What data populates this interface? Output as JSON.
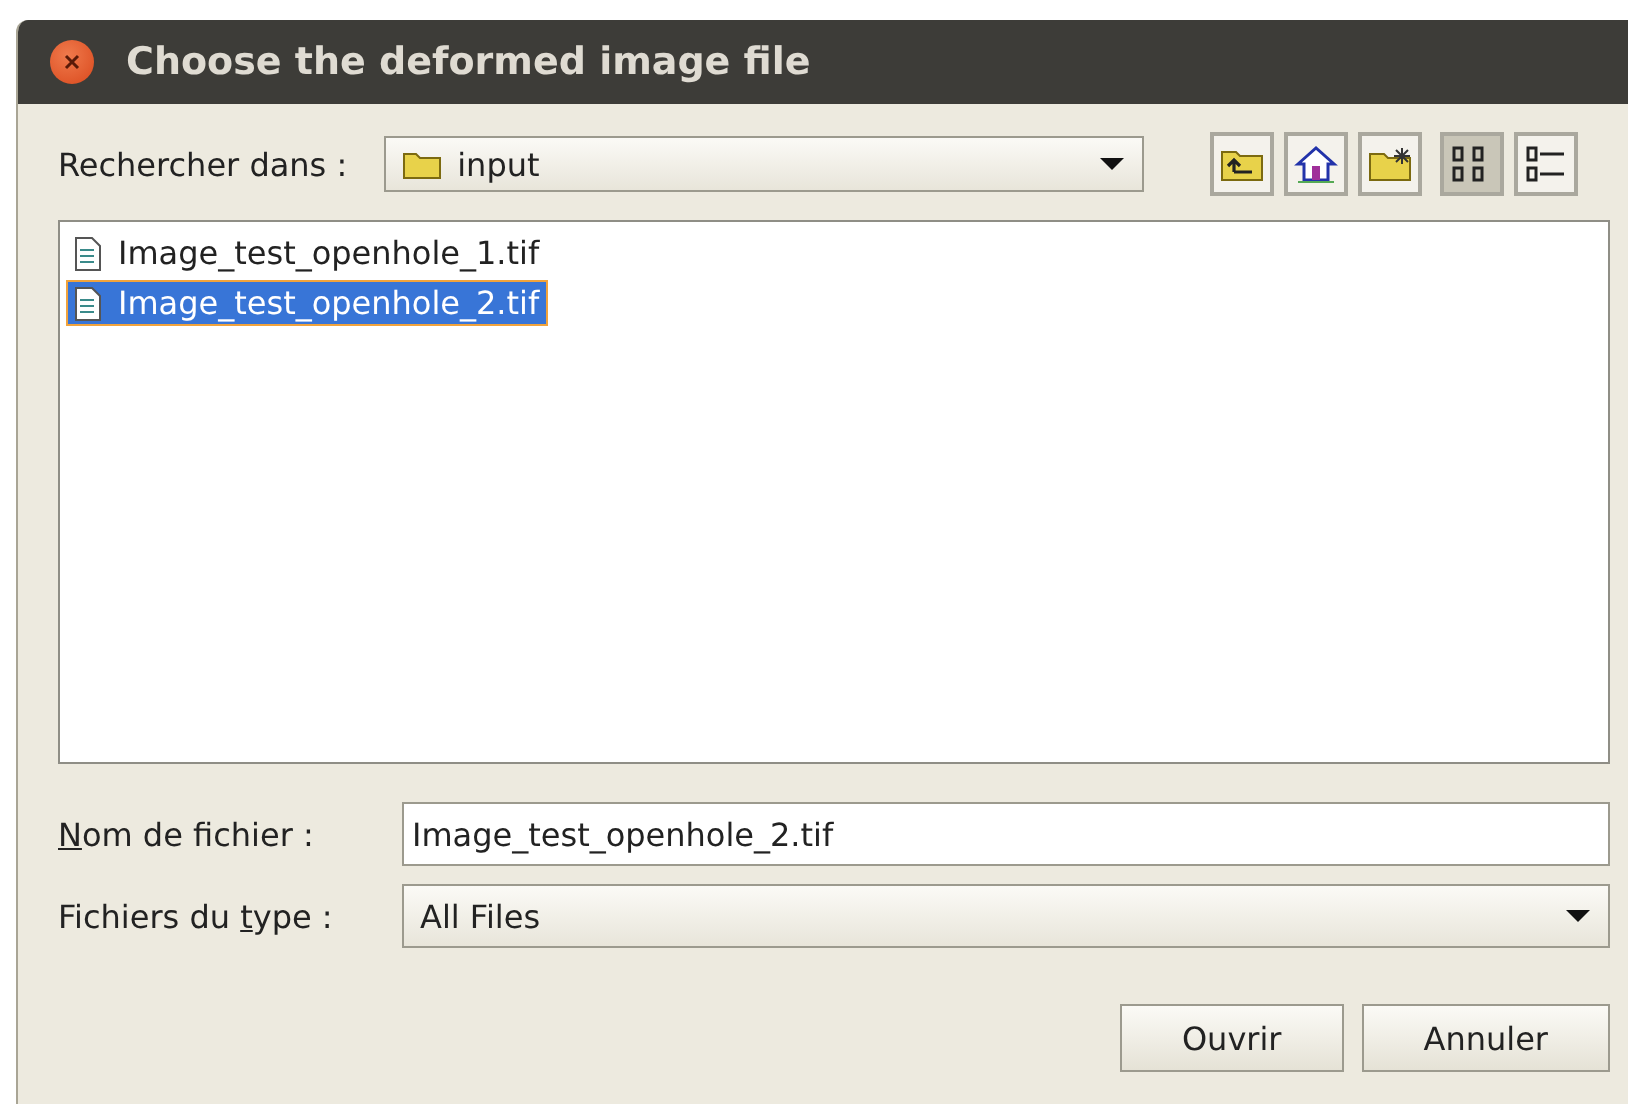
{
  "window": {
    "title": "Choose the deformed image file"
  },
  "look_in": {
    "label": "Rechercher dans :",
    "value": "input"
  },
  "toolbar": [
    {
      "kind": "up",
      "selected": false
    },
    {
      "kind": "home",
      "selected": false
    },
    {
      "kind": "new-folder",
      "selected": false
    },
    {
      "kind": "list-view",
      "selected": true
    },
    {
      "kind": "details-view",
      "selected": false
    }
  ],
  "files": [
    {
      "name": "Image_test_openhole_1.tif",
      "selected": false
    },
    {
      "name": "Image_test_openhole_2.tif",
      "selected": true
    }
  ],
  "file_name": {
    "label": [
      {
        "text": "N",
        "underlined": true
      },
      {
        "text": "om de fichier :",
        "underlined": false
      }
    ],
    "value": "Image_test_openhole_2.tif"
  },
  "file_type": {
    "label": [
      {
        "text": "Fichiers du ",
        "underlined": false
      },
      {
        "text": "t",
        "underlined": true
      },
      {
        "text": "ype :",
        "underlined": false
      }
    ],
    "value": "All Files"
  },
  "buttons": [
    "Ouvrir",
    "Annuler"
  ]
}
